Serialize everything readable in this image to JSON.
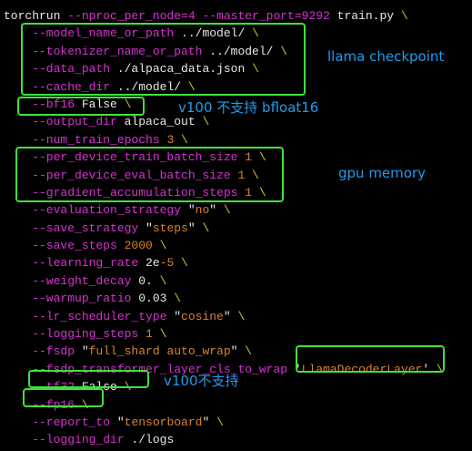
{
  "colors": {
    "flag": "#d633d0",
    "string": "#d9822b",
    "backslash": "#d8c326",
    "plain": "#e8e8e8",
    "highlight": "#3fe23a",
    "note": "#1f9cf0"
  },
  "lines": [
    {
      "tokens": [
        {
          "t": "torchrun ",
          "c": "w"
        },
        {
          "t": "--nproc_per_node=4 --master_port=9292",
          "c": "f"
        },
        {
          "t": " train.py ",
          "c": "w"
        },
        {
          "t": "\\",
          "c": "y"
        }
      ]
    },
    {
      "tokens": [
        {
          "t": "    --model_name_or_path",
          "c": "f"
        },
        {
          "t": " ../model/ ",
          "c": "w"
        },
        {
          "t": "\\",
          "c": "y"
        }
      ]
    },
    {
      "tokens": [
        {
          "t": "    --tokenizer_name_or_path",
          "c": "f"
        },
        {
          "t": " ../model/ ",
          "c": "w"
        },
        {
          "t": "\\",
          "c": "y"
        }
      ]
    },
    {
      "tokens": [
        {
          "t": "    --data_path",
          "c": "f"
        },
        {
          "t": " ./alpaca_data.json ",
          "c": "w"
        },
        {
          "t": "\\",
          "c": "y"
        }
      ]
    },
    {
      "tokens": [
        {
          "t": "    --cache_dir",
          "c": "f"
        },
        {
          "t": " ../model/ ",
          "c": "w"
        },
        {
          "t": "\\",
          "c": "y"
        }
      ]
    },
    {
      "tokens": [
        {
          "t": "    --bf16",
          "c": "f"
        },
        {
          "t": " False ",
          "c": "w"
        },
        {
          "t": "\\",
          "c": "y"
        }
      ]
    },
    {
      "tokens": [
        {
          "t": "    --output_dir",
          "c": "f"
        },
        {
          "t": " alpaca_out ",
          "c": "w"
        },
        {
          "t": "\\",
          "c": "y"
        }
      ]
    },
    {
      "tokens": [
        {
          "t": "    --num_train_epochs",
          "c": "f"
        },
        {
          "t": " 3 ",
          "c": "s"
        },
        {
          "t": "\\",
          "c": "y"
        }
      ]
    },
    {
      "tokens": [
        {
          "t": "    --per_device_train_batch_size",
          "c": "f"
        },
        {
          "t": " 1 ",
          "c": "s"
        },
        {
          "t": "\\",
          "c": "y"
        }
      ]
    },
    {
      "tokens": [
        {
          "t": "    --per_device_eval_batch_size",
          "c": "f"
        },
        {
          "t": " 1 ",
          "c": "s"
        },
        {
          "t": "\\",
          "c": "y"
        }
      ]
    },
    {
      "tokens": [
        {
          "t": "    --gradient_accumulation_steps",
          "c": "f"
        },
        {
          "t": " 1 ",
          "c": "s"
        },
        {
          "t": "\\",
          "c": "y"
        }
      ]
    },
    {
      "tokens": [
        {
          "t": "    --evaluation_strategy",
          "c": "f"
        },
        {
          "t": " \"",
          "c": "w"
        },
        {
          "t": "no",
          "c": "s"
        },
        {
          "t": "\" ",
          "c": "w"
        },
        {
          "t": "\\",
          "c": "y"
        }
      ]
    },
    {
      "tokens": [
        {
          "t": "    --save_strategy",
          "c": "f"
        },
        {
          "t": " \"",
          "c": "w"
        },
        {
          "t": "steps",
          "c": "s"
        },
        {
          "t": "\" ",
          "c": "w"
        },
        {
          "t": "\\",
          "c": "y"
        }
      ]
    },
    {
      "tokens": [
        {
          "t": "    --save_steps",
          "c": "f"
        },
        {
          "t": " 2000 ",
          "c": "s"
        },
        {
          "t": "\\",
          "c": "y"
        }
      ]
    },
    {
      "tokens": [
        {
          "t": "    --learning_rate",
          "c": "f"
        },
        {
          "t": " 2e",
          "c": "w"
        },
        {
          "t": "-5 ",
          "c": "s"
        },
        {
          "t": "\\",
          "c": "y"
        }
      ]
    },
    {
      "tokens": [
        {
          "t": "    --weight_decay",
          "c": "f"
        },
        {
          "t": " 0. ",
          "c": "w"
        },
        {
          "t": "\\",
          "c": "y"
        }
      ]
    },
    {
      "tokens": [
        {
          "t": "    --warmup_ratio",
          "c": "f"
        },
        {
          "t": " 0.03 ",
          "c": "w"
        },
        {
          "t": "\\",
          "c": "y"
        }
      ]
    },
    {
      "tokens": [
        {
          "t": "    --lr_scheduler_type",
          "c": "f"
        },
        {
          "t": " \"",
          "c": "w"
        },
        {
          "t": "cosine",
          "c": "s"
        },
        {
          "t": "\" ",
          "c": "w"
        },
        {
          "t": "\\",
          "c": "y"
        }
      ]
    },
    {
      "tokens": [
        {
          "t": "    --logging_steps",
          "c": "f"
        },
        {
          "t": " 1 ",
          "c": "s"
        },
        {
          "t": "\\",
          "c": "y"
        }
      ]
    },
    {
      "tokens": [
        {
          "t": "    --fsdp",
          "c": "f"
        },
        {
          "t": " \"",
          "c": "w"
        },
        {
          "t": "full_shard auto_wrap",
          "c": "s"
        },
        {
          "t": "\" ",
          "c": "w"
        },
        {
          "t": "\\",
          "c": "y"
        }
      ]
    },
    {
      "tokens": [
        {
          "t": "    --fsdp_transformer_layer_cls_to_wrap",
          "c": "f"
        },
        {
          "t": " '",
          "c": "w"
        },
        {
          "t": "LlamaDecoderLayer",
          "c": "s"
        },
        {
          "t": "' ",
          "c": "w"
        },
        {
          "t": "\\",
          "c": "y"
        }
      ]
    },
    {
      "tokens": [
        {
          "t": "    --tf32",
          "c": "f"
        },
        {
          "t": " False ",
          "c": "w"
        },
        {
          "t": "\\",
          "c": "y"
        }
      ]
    },
    {
      "tokens": [
        {
          "t": "    --fp16 ",
          "c": "f"
        },
        {
          "t": "\\",
          "c": "y"
        }
      ]
    },
    {
      "tokens": [
        {
          "t": "    --report_to",
          "c": "f"
        },
        {
          "t": " \"",
          "c": "w"
        },
        {
          "t": "tensorboard",
          "c": "s"
        },
        {
          "t": "\" ",
          "c": "w"
        },
        {
          "t": "\\",
          "c": "y"
        }
      ]
    },
    {
      "tokens": [
        {
          "t": "    --logging_dir",
          "c": "f"
        },
        {
          "t": " ./logs",
          "c": "w"
        }
      ]
    }
  ],
  "annotations": {
    "checkpoint": "llama checkpoint",
    "bf16": "v100 不支持 bfloat16",
    "gpu": "gpu memory",
    "tf32": "v100不支持"
  }
}
